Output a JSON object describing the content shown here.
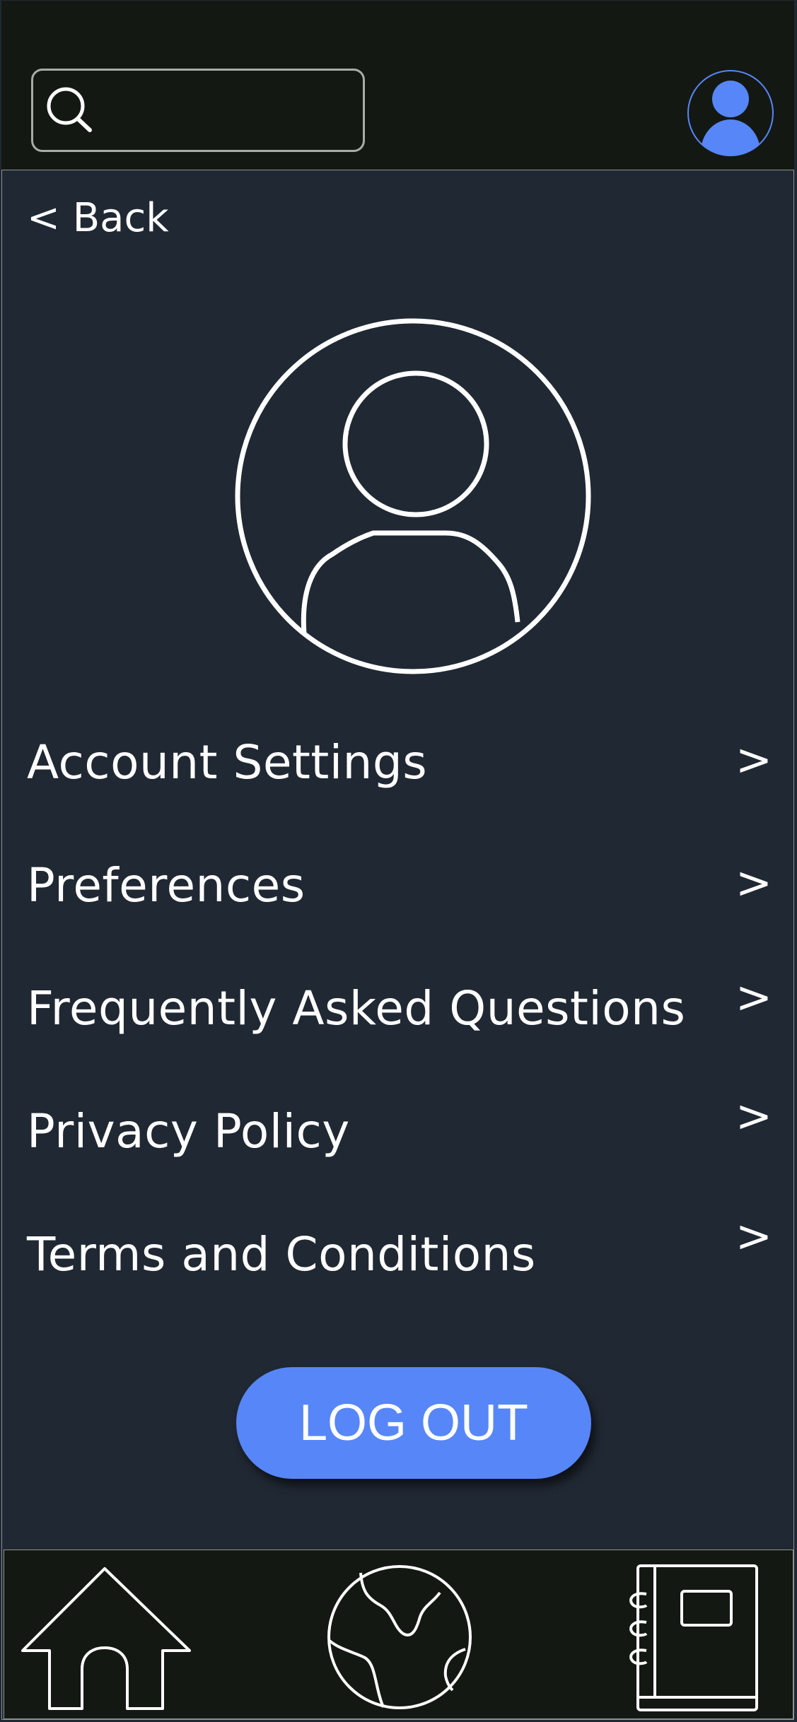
{
  "header": {
    "search": {
      "placeholder": ""
    },
    "avatar_color": "#5786f8",
    "icons": [
      "search-icon",
      "user-avatar-icon"
    ]
  },
  "back": {
    "label": "< Back"
  },
  "profile": {
    "icon": "user-profile-icon"
  },
  "menu": {
    "items": [
      {
        "label": "Account Settings",
        "chevron": ">"
      },
      {
        "label": "Preferences",
        "chevron": ">"
      },
      {
        "label": "Frequently Asked Questions",
        "chevron": ">"
      },
      {
        "label": "Privacy Policy",
        "chevron": ">"
      },
      {
        "label": "Terms and Conditions",
        "chevron": ">"
      }
    ]
  },
  "logout": {
    "label": "LOG OUT",
    "color": "#5786f8"
  },
  "bottom_nav": {
    "items": [
      {
        "icon": "home-icon"
      },
      {
        "icon": "globe-icon"
      },
      {
        "icon": "notebook-icon"
      }
    ]
  },
  "colors": {
    "background": "#202833",
    "bars": "#141813",
    "accent": "#5786f8",
    "text": "#ffffff"
  }
}
